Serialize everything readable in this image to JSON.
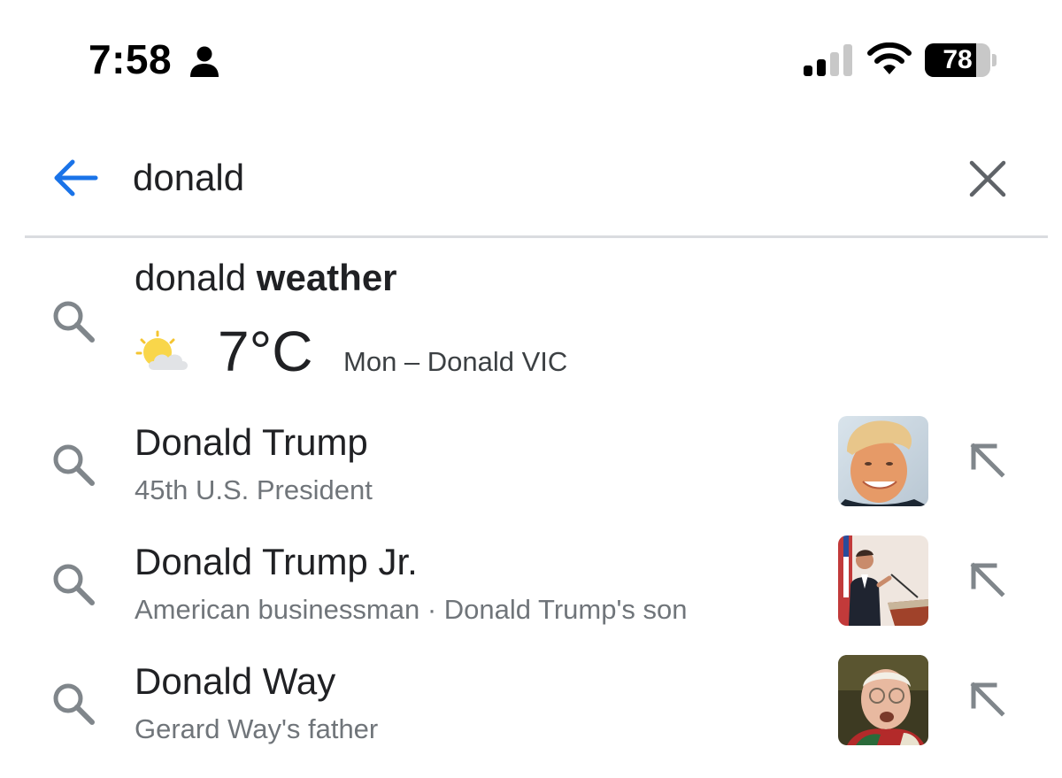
{
  "status_bar": {
    "time": "7:58",
    "battery_level": "78",
    "battery_fraction": 0.78,
    "signal_bars_active": 2,
    "signal_bars_total": 4,
    "icons": [
      "person-icon",
      "signal-icon",
      "wifi-icon",
      "battery-icon"
    ]
  },
  "search": {
    "query": "donald",
    "back_icon": "arrow-left-icon",
    "clear_icon": "close-icon",
    "accent_color": "#1a73e8"
  },
  "suggestions": [
    {
      "title_prefix": "donald ",
      "title_bold": "weather",
      "temperature": "7°C",
      "detail": "Mon – Donald VIC",
      "icon": "partly-cloudy-icon"
    },
    {
      "title": "Donald Trump",
      "subtitle": "45th U.S. President",
      "thumbnail": "portrait-thumbnail"
    },
    {
      "title": "Donald Trump Jr.",
      "subtitle": "American businessman · Donald Trump's son",
      "thumbnail": "speaker-thumbnail"
    },
    {
      "title": "Donald Way",
      "subtitle": "Gerard Way's father",
      "thumbnail": "portrait-thumbnail"
    }
  ]
}
